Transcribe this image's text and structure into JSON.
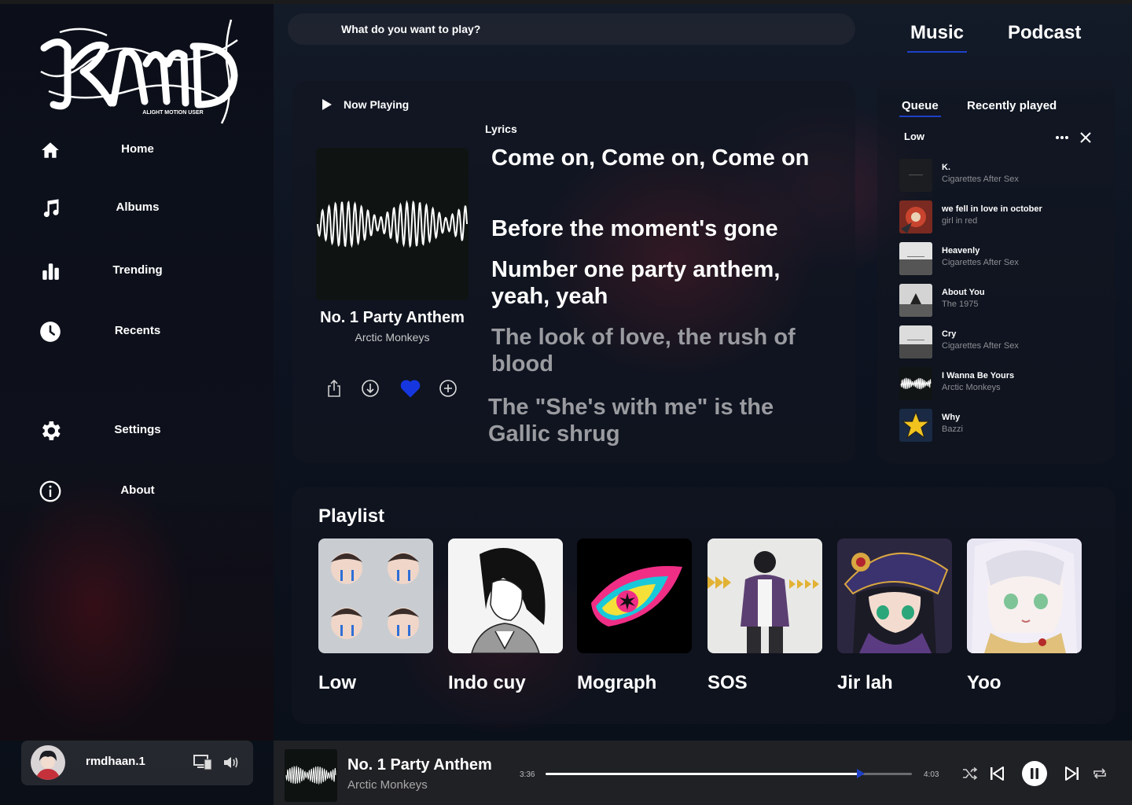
{
  "app": {
    "logo_text": "KMD",
    "logo_sub": "ALIGHT MOTION USER"
  },
  "sidebar": {
    "items": [
      {
        "label": "Home",
        "icon": "home-icon"
      },
      {
        "label": "Albums",
        "icon": "music-note-icon"
      },
      {
        "label": "Trending",
        "icon": "bar-chart-icon"
      },
      {
        "label": "Recents",
        "icon": "clock-icon"
      },
      {
        "label": "Settings",
        "icon": "gear-icon"
      },
      {
        "label": "About",
        "icon": "info-icon"
      }
    ]
  },
  "user": {
    "name": "rmdhaan.1"
  },
  "search": {
    "placeholder": "What do you want to play?"
  },
  "top_tabs": [
    {
      "label": "Music",
      "active": true
    },
    {
      "label": "Podcast",
      "active": false
    }
  ],
  "now_playing": {
    "heading": "Now Playing",
    "title": "No. 1 Party Anthem",
    "artist": "Arctic Monkeys",
    "liked": true,
    "lyrics_label": "Lyrics",
    "lyrics": [
      {
        "text": "Come on, Come on, Come on",
        "active": true
      },
      {
        "text": "Before the moment's gone",
        "active": true
      },
      {
        "text": "Number one party anthem, yeah, yeah",
        "active": true
      },
      {
        "text": "The look of love, the rush of blood",
        "active": false
      },
      {
        "text": "The \"She's with me\" is the Gallic shrug",
        "active": false
      }
    ]
  },
  "queue": {
    "tabs": [
      {
        "label": "Queue",
        "active": true
      },
      {
        "label": "Recently played",
        "active": false
      }
    ],
    "current": "Low",
    "items": [
      {
        "title": "K.",
        "artist": "Cigarettes After Sex"
      },
      {
        "title": "we fell in love in october",
        "artist": "girl in red"
      },
      {
        "title": "Heavenly",
        "artist": "Cigarettes After Sex"
      },
      {
        "title": "About You",
        "artist": "The 1975"
      },
      {
        "title": "Cry",
        "artist": "Cigarettes After Sex"
      },
      {
        "title": "I Wanna Be Yours",
        "artist": "Arctic Monkeys"
      },
      {
        "title": "Why",
        "artist": "Bazzi"
      }
    ]
  },
  "playlist": {
    "heading": "Playlist",
    "items": [
      {
        "name": "Low"
      },
      {
        "name": "Indo cuy"
      },
      {
        "name": "Mograph"
      },
      {
        "name": "SOS"
      },
      {
        "name": "Jir lah"
      },
      {
        "name": "Yoo"
      }
    ]
  },
  "player": {
    "title": "No. 1 Party Anthem",
    "artist": "Arctic Monkeys",
    "elapsed": "3:36",
    "duration": "4:03",
    "progress": 0.86
  },
  "colors": {
    "accent": "#1e40c8",
    "like": "#1637e0"
  }
}
